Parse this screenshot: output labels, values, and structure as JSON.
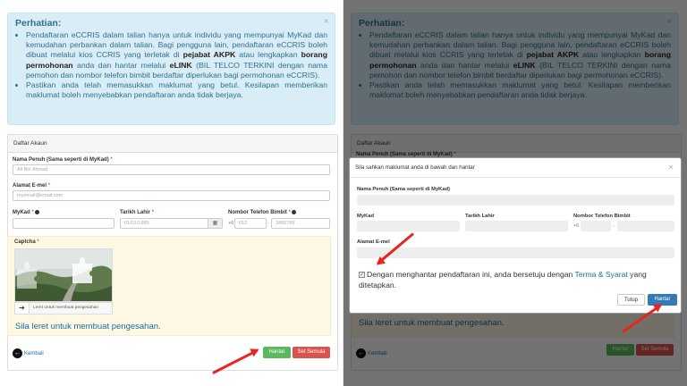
{
  "notice": {
    "title": "Perhatian:",
    "item1_part1": "Pendaftaran eCCRIS dalam talian hanya untuk individu yang mempunyai MyKad dan kemudahan perbankan dalam talian. Bagi pengguna lain, pendaftaran eCCRIS boleh dibuat melalui kios CCRIS yang terletak di ",
    "item1_bold1": "pejabat AKPK",
    "item1_part2": " atau lengkapkan ",
    "item1_bold2": "borang permohonan",
    "item1_part3": " anda dan hantar melalui ",
    "item1_bold3": "eLINK",
    "item1_part4": " (BIL TELCO TERKINI dengan nama pemohon dan nombor telefon bimbit berdaftar diperlukan bagi permohonan eCCRIS).",
    "item2": "Pastikan anda telah memasukkan maklumat yang betul. Kesilapan memberikan maklumat boleh menyebabkan pendaftaran anda tidak berjaya.",
    "close": "×"
  },
  "form": {
    "header": "Daftar Akaun",
    "name_label": "Nama Penuh (Sama seperti di MyKad)",
    "name_placeholder": "Ali Bin Ahmad",
    "email_label": "Alamat E-mel",
    "email_placeholder": "myemail@email.com",
    "mykad_label": "MyKad",
    "dob_label": "Tarikh Lahir",
    "dob_placeholder": "01/01/1985",
    "phone_label": "Nombor Telefon Bimbit",
    "phone_prefix": "+6",
    "phone_area": "012",
    "phone_dash": "-",
    "phone_number": "3456789",
    "captcha_label": "Captcha",
    "slider_text": "Leret untuk membuat pengesahan",
    "captcha_hint": "Sila leret untuk membuat pengesahan.",
    "back_label": "Kembali",
    "submit_label": "Hantar",
    "reset_label": "Set Semula",
    "required_mark": "*"
  },
  "modal": {
    "title": "Sila sahkan maklumat anda di bawah dan hantar",
    "close": "×",
    "name_label": "Nama Penuh (Sama seperti di MyKad)",
    "mykad_label": "MyKad",
    "dob_label": "Tarikh Lahir",
    "phone_label": "Nombor Telefon Bimbit",
    "phone_prefix": "+6",
    "phone_dash": "-",
    "email_label": "Alamat E-mel",
    "agree_part1": "Dengan menghantar pendaftaran ini, anda bersetuju dengan ",
    "agree_link": "Terma & Syarat",
    "agree_part2": " yang ditetapkan.",
    "cancel_label": "Tutup",
    "submit_label": "Hantar"
  },
  "colors": {
    "accent_arrow": "#e8251f",
    "primary": "#337ab7",
    "success": "#5cb85c",
    "danger": "#d9534f",
    "info_bg": "#d9edf7"
  }
}
